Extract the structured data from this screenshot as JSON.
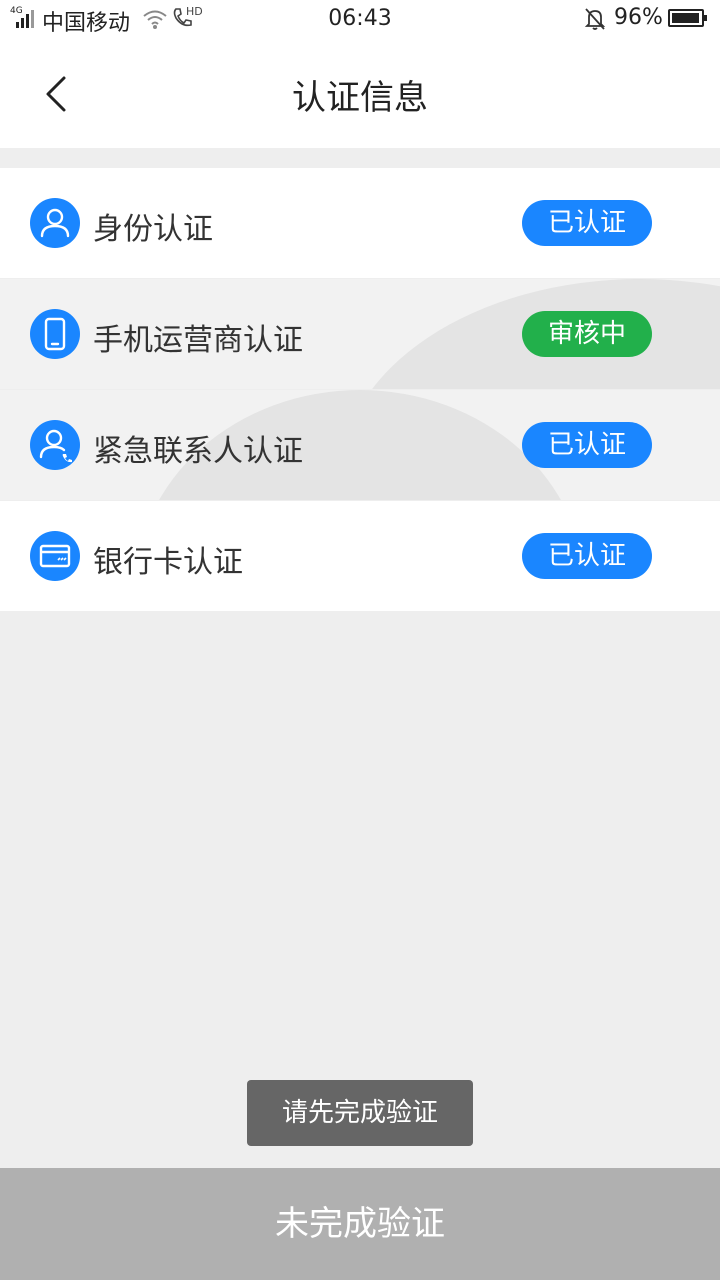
{
  "status_bar": {
    "network": "4G",
    "carrier": "中国移动",
    "call_badge": "HD",
    "time": "06:43",
    "battery": "96%"
  },
  "header": {
    "title": "认证信息",
    "back_icon": "chevron-left-icon"
  },
  "items": [
    {
      "label": "身份认证",
      "status": "已认证",
      "icon": "person-icon",
      "status_color": "#1a86ff"
    },
    {
      "label": "手机运营商认证",
      "status": "审核中",
      "icon": "phone-icon",
      "status_color": "#22b04b"
    },
    {
      "label": "紧急联系人认证",
      "status": "已认证",
      "icon": "contact-icon",
      "status_color": "#1a86ff"
    },
    {
      "label": "银行卡认证",
      "status": "已认证",
      "icon": "bank-card-icon",
      "status_color": "#1a86ff"
    }
  ],
  "toast": {
    "text": "请先完成验证"
  },
  "footer": {
    "button_label": "未完成验证"
  },
  "colors": {
    "accent": "#1a86ff",
    "pending": "#22b04b",
    "disabled": "#b0b0b0",
    "background": "#eeeeee"
  }
}
